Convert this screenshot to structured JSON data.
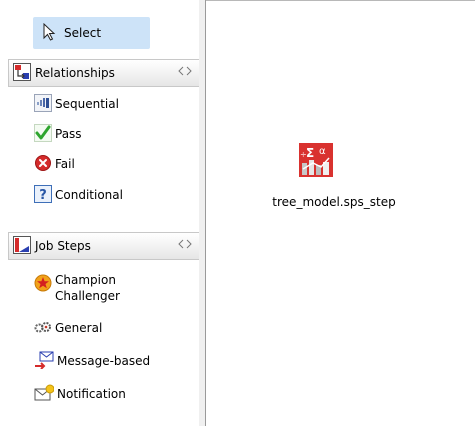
{
  "palette": {
    "select_label": "Select",
    "drawers": [
      {
        "label": "Relationships",
        "items": [
          {
            "label": "Sequential",
            "icon": "sequential-icon"
          },
          {
            "label": "Pass",
            "icon": "check-icon"
          },
          {
            "label": "Fail",
            "icon": "fail-icon"
          },
          {
            "label": "Conditional",
            "icon": "question-icon"
          }
        ]
      },
      {
        "label": "Job Steps",
        "items": [
          {
            "label_line1": "Champion",
            "label_line2": "Challenger",
            "icon": "star-icon"
          },
          {
            "label": "General",
            "icon": "gears-icon"
          },
          {
            "label": "Message-based",
            "icon": "message-icon"
          },
          {
            "label": "Notification",
            "icon": "notification-icon"
          }
        ]
      }
    ]
  },
  "canvas": {
    "node_label": "tree_model.sps_step",
    "node_icon": "sps-step-icon"
  },
  "colors": {
    "select_highlight": "#cde3f8",
    "fail_red": "#d42b2b",
    "pass_green": "#2ea52e",
    "node_red": "#d9322f"
  }
}
